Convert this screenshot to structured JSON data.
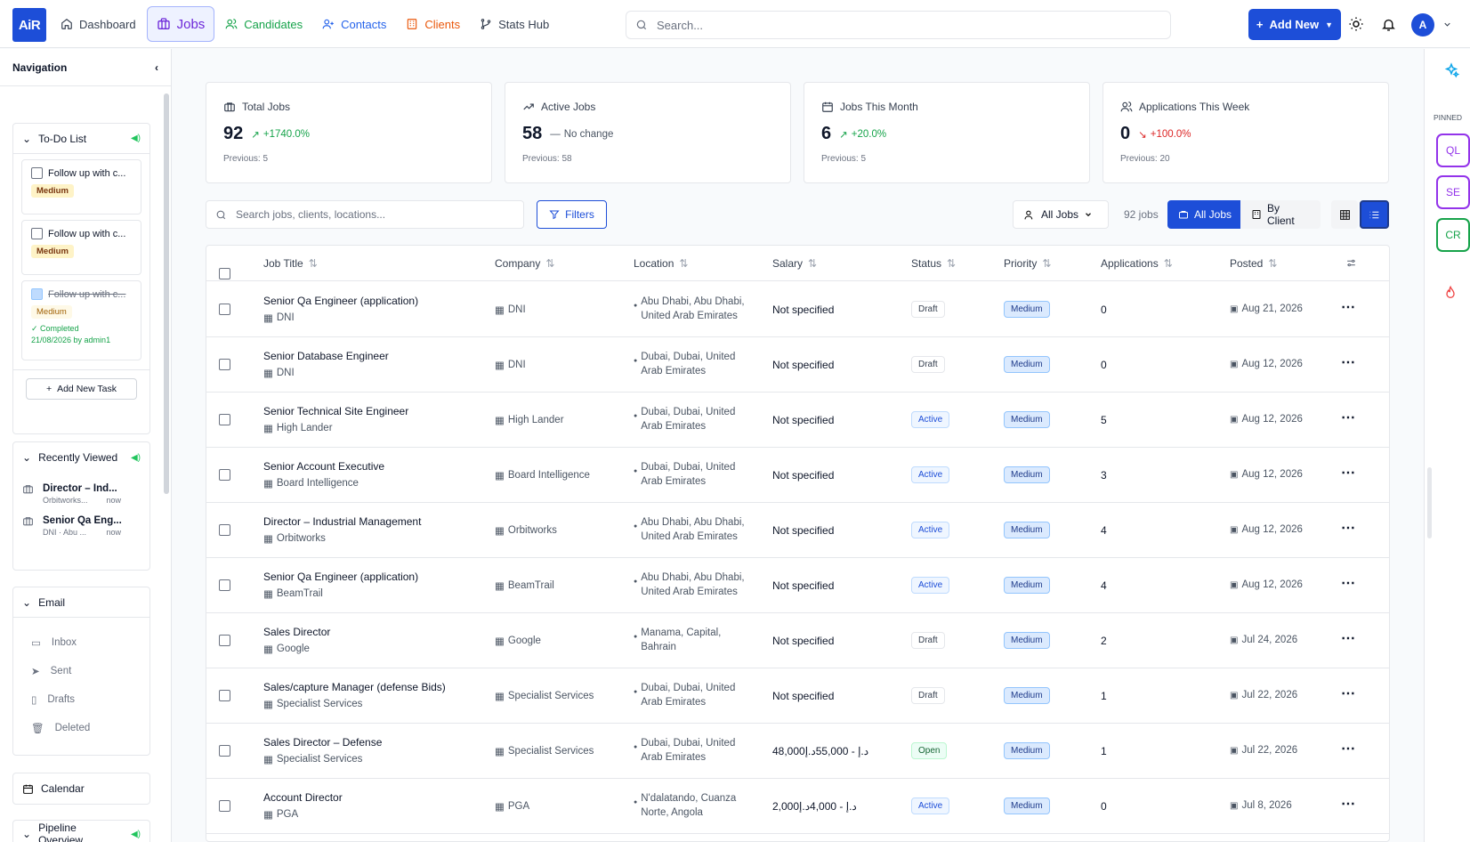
{
  "app": {
    "logo": "AiR"
  },
  "nav": {
    "items": [
      {
        "label": "Dashboard",
        "icon": "home-icon",
        "color": "#374151"
      },
      {
        "label": "Jobs",
        "icon": "briefcase-icon",
        "color": "#6d28d9",
        "active": true
      },
      {
        "label": "Candidates",
        "icon": "users-icon",
        "color": "#16a34a"
      },
      {
        "label": "Contacts",
        "icon": "user-plus-icon",
        "color": "#2563eb"
      },
      {
        "label": "Clients",
        "icon": "building-icon",
        "color": "#ea580c"
      },
      {
        "label": "Stats Hub",
        "icon": "git-branch-icon",
        "color": "#374151"
      }
    ]
  },
  "search": {
    "placeholder": "Search..."
  },
  "header": {
    "add_new": "Add New",
    "avatar": "A"
  },
  "sidebar": {
    "title": "Navigation",
    "todo": {
      "title": "To-Do List",
      "tasks": [
        {
          "text": "Follow up with c...",
          "priority": "Medium",
          "done": false
        },
        {
          "text": "Follow up with c...",
          "priority": "Medium",
          "done": false
        },
        {
          "text": "Follow up with c...",
          "priority": "Medium",
          "done": true,
          "completed_label": "Completed",
          "completed_meta": "21/08/2026 by admin1"
        }
      ],
      "add_label": "Add New Task"
    },
    "recently_viewed": {
      "title": "Recently Viewed",
      "items": [
        {
          "title": "Director – Ind...",
          "sub": "Orbitworks...",
          "time": "now"
        },
        {
          "title": "Senior Qa Eng...",
          "sub": "DNI · Abu ...",
          "time": "now"
        }
      ]
    },
    "email": {
      "title": "Email",
      "items": [
        "Inbox",
        "Sent",
        "Drafts",
        "Deleted"
      ]
    },
    "calendar": "Calendar",
    "pipeline": "Pipeline Overview"
  },
  "stats": [
    {
      "label": "Total Jobs",
      "value": "92",
      "change": "+1740.0%",
      "trend": "up",
      "previous": "Previous: 5"
    },
    {
      "label": "Active Jobs",
      "value": "58",
      "change": "No change",
      "trend": "flat",
      "previous": "Previous: 58"
    },
    {
      "label": "Jobs This Month",
      "value": "6",
      "change": "+20.0%",
      "trend": "up",
      "previous": "Previous: 5"
    },
    {
      "label": "Applications This Week",
      "value": "0",
      "change": "+100.0%",
      "trend": "down",
      "previous": "Previous: 20"
    }
  ],
  "toolbar": {
    "search_placeholder": "Search jobs, clients, locations...",
    "filters": "Filters",
    "all_jobs_dropdown": "All Jobs",
    "count": "92 jobs",
    "view_all": "All Jobs",
    "view_client": "By Client"
  },
  "table": {
    "headers": [
      "Job Title",
      "Company",
      "Location",
      "Salary",
      "Status",
      "Priority",
      "Applications",
      "Posted"
    ],
    "rows": [
      {
        "title": "Senior Qa Engineer (application)",
        "company": "DNI",
        "location1": "Abu Dhabi, Abu Dhabi,",
        "location2": "United Arab Emirates",
        "salary": "Not specified",
        "status": "Draft",
        "priority": "Medium",
        "apps": "0",
        "posted": "Aug 21, 2026"
      },
      {
        "title": "Senior Database Engineer",
        "company": "DNI",
        "location1": "Dubai, Dubai, United",
        "location2": "Arab Emirates",
        "salary": "Not specified",
        "status": "Draft",
        "priority": "Medium",
        "apps": "0",
        "posted": "Aug 12, 2026"
      },
      {
        "title": "Senior Technical Site Engineer",
        "company": "High Lander",
        "location1": "Dubai, Dubai, United",
        "location2": "Arab Emirates",
        "salary": "Not specified",
        "status": "Active",
        "priority": "Medium",
        "apps": "5",
        "posted": "Aug 12, 2026"
      },
      {
        "title": "Senior Account Executive",
        "company": "Board Intelligence",
        "location1": "Dubai, Dubai, United",
        "location2": "Arab Emirates",
        "salary": "Not specified",
        "status": "Active",
        "priority": "Medium",
        "apps": "3",
        "posted": "Aug 12, 2026"
      },
      {
        "title": "Director – Industrial Management",
        "company": "Orbitworks",
        "location1": "Abu Dhabi, Abu Dhabi,",
        "location2": "United Arab Emirates",
        "salary": "Not specified",
        "status": "Active",
        "priority": "Medium",
        "apps": "4",
        "posted": "Aug 12, 2026"
      },
      {
        "title": "Senior Qa Engineer (application)",
        "company": "BeamTrail",
        "location1": "Abu Dhabi, Abu Dhabi,",
        "location2": "United Arab Emirates",
        "salary": "Not specified",
        "status": "Active",
        "priority": "Medium",
        "apps": "4",
        "posted": "Aug 12, 2026"
      },
      {
        "title": "Sales Director",
        "company": "Google",
        "location1": "Manama, Capital,",
        "location2": "Bahrain",
        "salary": "Not specified",
        "status": "Draft",
        "priority": "Medium",
        "apps": "2",
        "posted": "Jul 24, 2026"
      },
      {
        "title": "Sales/capture Manager (defense Bids)",
        "company": "Specialist Services",
        "location1": "Dubai, Dubai, United",
        "location2": "Arab Emirates",
        "salary": "Not specified",
        "status": "Draft",
        "priority": "Medium",
        "apps": "1",
        "posted": "Jul 22, 2026"
      },
      {
        "title": "Sales Director – Defense",
        "company": "Specialist Services",
        "location1": "Dubai, Dubai, United",
        "location2": "Arab Emirates",
        "salary": "48,000د.إ - 55,000د.إ",
        "status": "Open",
        "priority": "Medium",
        "apps": "1",
        "posted": "Jul 22, 2026"
      },
      {
        "title": "Account Director",
        "company": "PGA",
        "location1": "N'dalatando, Cuanza",
        "location2": "Norte, Angola",
        "salary": "2,000د.إ - 4,000د.إ",
        "status": "Active",
        "priority": "Medium",
        "apps": "0",
        "posted": "Jul 8, 2026"
      }
    ]
  },
  "pinned": {
    "label": "PINNED",
    "items": [
      {
        "label": "QL",
        "color": "#9333ea"
      },
      {
        "label": "SE",
        "color": "#9333ea"
      },
      {
        "label": "CR",
        "color": "#16a34a"
      }
    ]
  }
}
